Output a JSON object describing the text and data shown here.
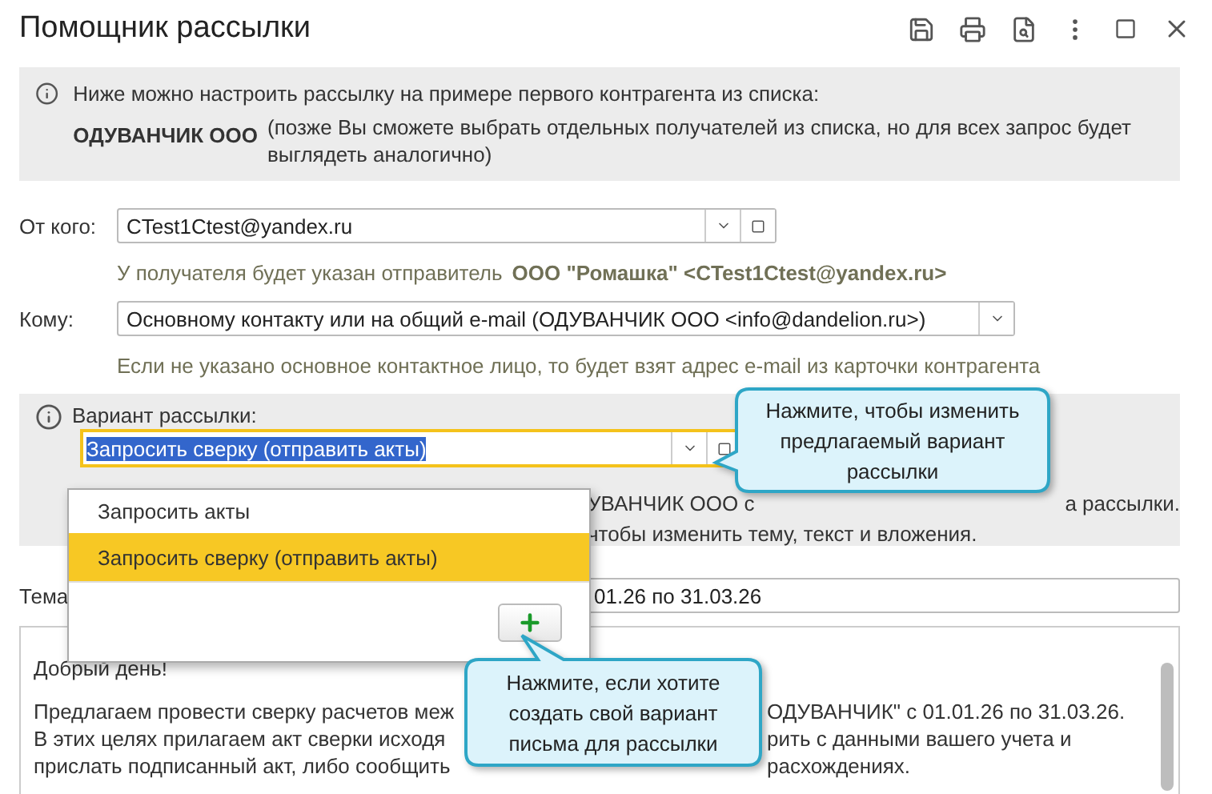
{
  "window": {
    "title": "Помощник рассылки"
  },
  "intro": {
    "text": "Ниже можно настроить рассылку на примере первого контрагента из списка:",
    "recipient": "ОДУВАНЧИК ООО",
    "note": "(позже Вы сможете выбрать отдельных получателей из списка, но для всех запрос будет выглядеть аналогично)"
  },
  "from": {
    "label": "От кого:",
    "value": "CTest1Ctest@yandex.ru",
    "hint": "У получателя будет указан отправитель",
    "sender": "ООО \"Ромашка\" <CTest1Ctest@yandex.ru>"
  },
  "to": {
    "label": "Кому:",
    "value": "Основному контакту или на общий e-mail (ОДУВАНЧИК ООО <info@dandelion.ru>)",
    "hint": "Если не указано основное контактное лицо, то будет взят адрес e-mail из карточки контрагента"
  },
  "variant": {
    "label": "Вариант рассылки:",
    "value": "Запросить сверку (отправить акты)",
    "focused": true,
    "text_selected": true,
    "hint_lines": [
      {
        "left": "УВАНЧИК ООО с",
        "right": "а рассылки."
      },
      {
        "left": "чтобы изменить тему, текст и вложения."
      }
    ]
  },
  "dropdown": {
    "items": [
      {
        "label": "Запросить акты",
        "selected": false
      },
      {
        "label": "Запросить сверку (отправить акты)",
        "selected": true
      }
    ]
  },
  "subject": {
    "label": "Тема",
    "value": "01.26 по 31.03.26"
  },
  "body": {
    "lines": [
      {
        "left": "Добрый день!"
      },
      {
        "left": "Предлагаем провести сверку расчетов меж",
        "right": "ОДУВАНЧИК\" с 01.01.26 по 31.03.26."
      },
      {
        "left": "В этих целях прилагаем акт сверки исходя",
        "right": "рить с данными вашего учета и"
      },
      {
        "left": "прислать подписанный акт, либо сообщить",
        "right": "расхождениях."
      }
    ]
  },
  "callouts": [
    {
      "text": "Нажмите, чтобы изменить предлагаемый вариант рассылки"
    },
    {
      "text": "Нажмите, если хотите создать свой вариант письма для рассылки"
    }
  ]
}
